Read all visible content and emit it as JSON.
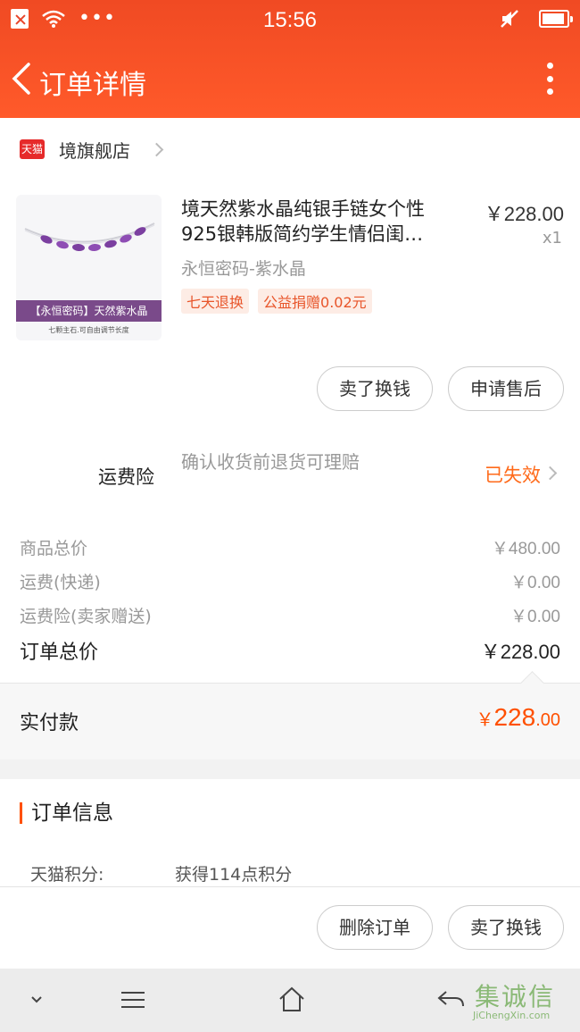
{
  "status_bar": {
    "time": "15:56"
  },
  "header": {
    "title": "订单详情"
  },
  "shop": {
    "badge": "天猫",
    "name": "境旗舰店"
  },
  "product": {
    "title_line1": "境天然紫水晶纯银手链女个性",
    "title_line2": "925银韩版简约学生情侣闺…",
    "price": "￥228.00",
    "quantity": "x1",
    "sku": "永恒密码-紫水晶",
    "tags": [
      "七天退换",
      "公益捐赠0.02元"
    ],
    "image_caption": "【永恒密码】天然紫水晶",
    "image_subcaption": "七颗主石.可自由调节长度",
    "actions": [
      "卖了换钱",
      "申请售后"
    ]
  },
  "insurance": {
    "label": "运费险",
    "description": "确认收货前退货可理赔",
    "status": "已失效"
  },
  "summary": [
    {
      "label": "商品总价",
      "value": "￥480.00"
    },
    {
      "label": "运费(快递)",
      "value": "￥0.00"
    },
    {
      "label": "运费险(卖家赠送)",
      "value": "￥0.00"
    }
  ],
  "order_total": {
    "label": "订单总价",
    "value": "￥228.00"
  },
  "paid": {
    "label": "实付款",
    "currency": "￥",
    "integer": "228",
    "decimal": ".00"
  },
  "order_info": {
    "title": "订单信息",
    "rows": [
      {
        "key": "天猫积分:",
        "value": "获得114点积分"
      }
    ]
  },
  "bottom_actions": [
    "删除订单",
    "卖了换钱"
  ],
  "watermark": {
    "text": "集诚信",
    "url": "JiChengXin.com"
  },
  "colors": {
    "header": "#f24c26",
    "accent": "#ff5000",
    "status_invalid": "#ff6a1a",
    "tmall_red": "#e62a2a"
  }
}
